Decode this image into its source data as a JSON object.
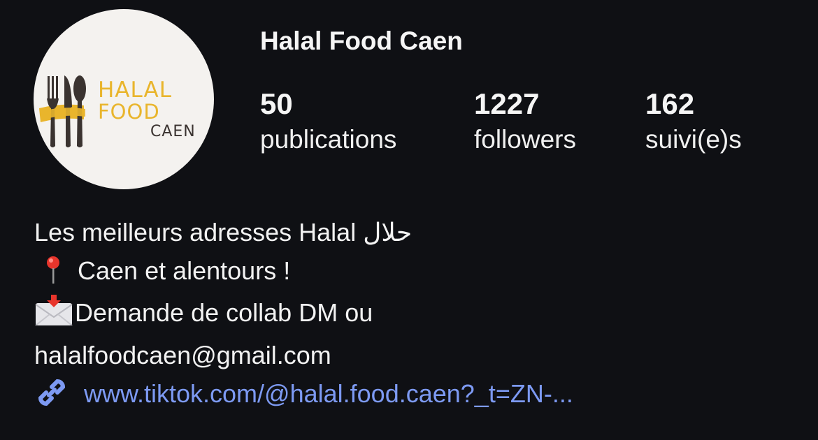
{
  "profile": {
    "name": "Halal Food Caen",
    "avatar": {
      "line1": "HALAL",
      "line2": "FOOD",
      "line3": "CAEN",
      "icon": "fork-knife-spoon-icon"
    }
  },
  "stats": {
    "posts": {
      "value": "50",
      "label": "publications"
    },
    "followers": {
      "value": "1227",
      "label": "followers"
    },
    "following": {
      "value": "162",
      "label": "suivi(e)s"
    }
  },
  "bio": {
    "line1": "Les meilleurs adresses Halal حلال",
    "line2": " Caen et alentours !",
    "line3": "Demande de collab DM ou",
    "line4": "halalfoodcaen@gmail.com",
    "line2_icon": "round-pushpin-icon",
    "line3_icon": "incoming-envelope-icon"
  },
  "link": {
    "text": "www.tiktok.com/@halal.food.caen?_t=ZN-...",
    "icon": "link-chain-icon"
  },
  "colors": {
    "background": "#0f1014",
    "text": "#f2f2f2",
    "link": "#7d9af3",
    "logo_gold": "#e9b52c",
    "logo_dark": "#3a3330"
  }
}
